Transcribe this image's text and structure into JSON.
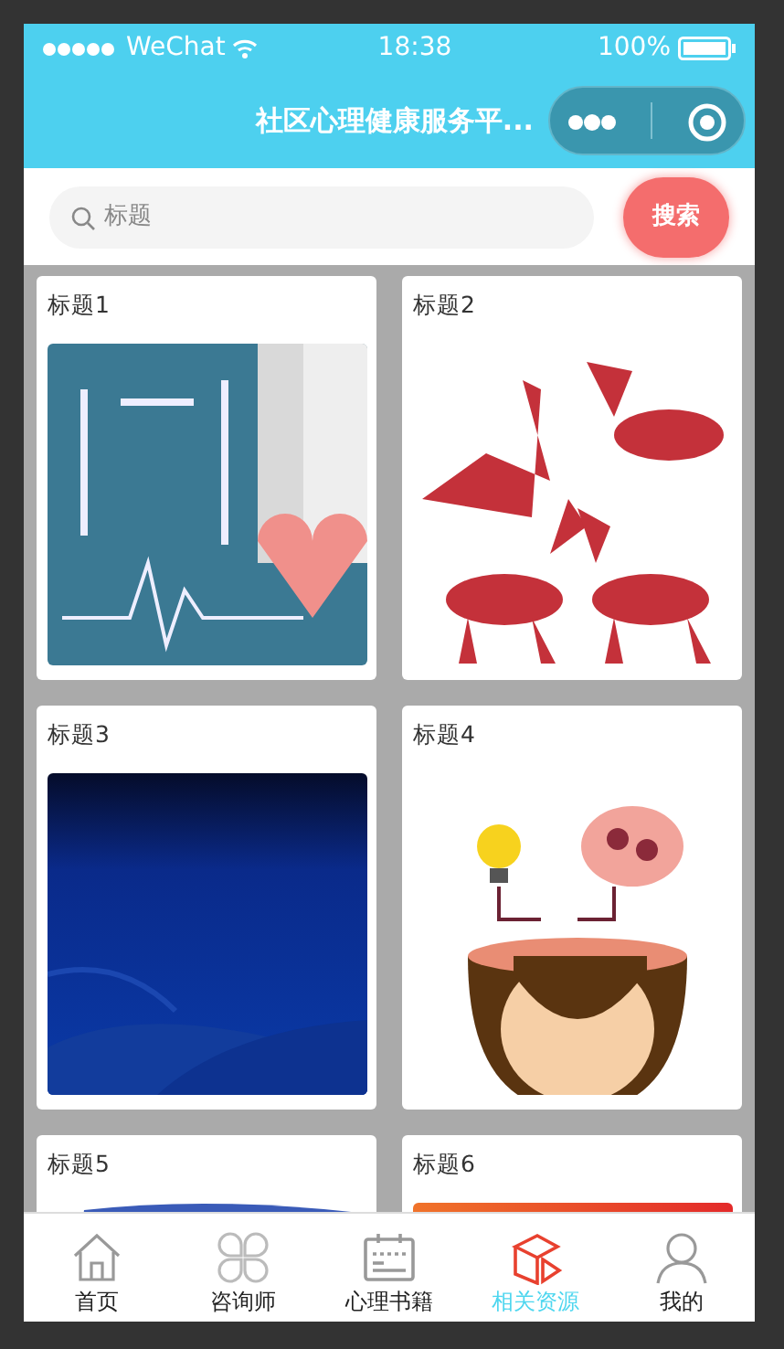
{
  "status_bar": {
    "carrier": "WeChat",
    "time": "18:38",
    "battery": "100%"
  },
  "nav_bar": {
    "title": "社区心理健康服务平..."
  },
  "search": {
    "placeholder": "标题",
    "button": "搜索"
  },
  "cards": [
    {
      "title": "标题1",
      "kind": "picture"
    },
    {
      "title": "标题2",
      "kind": "picture"
    },
    {
      "title": "标题3",
      "kind": "picture"
    },
    {
      "title": "标题4",
      "kind": "picture"
    },
    {
      "title": "标题5",
      "kind": "picture"
    },
    {
      "title": "标题6",
      "kind": "picture"
    }
  ],
  "tabs": [
    {
      "label": "首页",
      "kind": "home",
      "selected": false
    },
    {
      "label": "咨询师",
      "kind": "clover",
      "selected": false
    },
    {
      "label": "心理书籍",
      "kind": "book",
      "selected": false
    },
    {
      "label": "相关资源",
      "kind": "cube",
      "selected": true
    },
    {
      "label": "我的",
      "kind": "person",
      "selected": false
    }
  ]
}
